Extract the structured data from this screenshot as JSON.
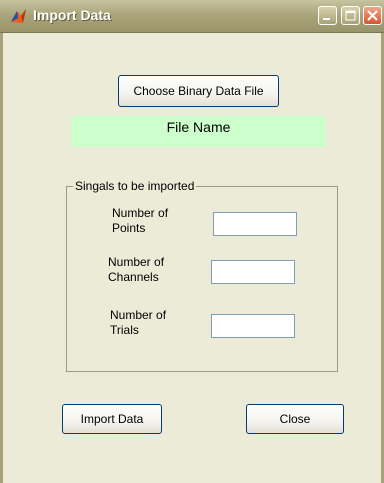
{
  "window": {
    "title": "Import Data",
    "controls": [
      "minimize-icon",
      "maximize-icon",
      "close-icon"
    ]
  },
  "toolbar": {
    "choose_file_label": "Choose Binary Data File"
  },
  "file": {
    "name_label": "File Name"
  },
  "signals": {
    "group_title": "Singals to be imported",
    "points_label_line1": "Number of",
    "points_label_line2": "Points",
    "points_value": "",
    "channels_label_line1": "Number of",
    "channels_label_line2": "Channels",
    "channels_value": "",
    "trials_label_line1": "Number of",
    "trials_label_line2": "Trials",
    "trials_value": ""
  },
  "actions": {
    "import_label": "Import Data",
    "close_label": "Close"
  },
  "colors": {
    "window_background": "#ecebd8",
    "file_name_background": "#ccffcc",
    "close_button": "#d2582f"
  }
}
